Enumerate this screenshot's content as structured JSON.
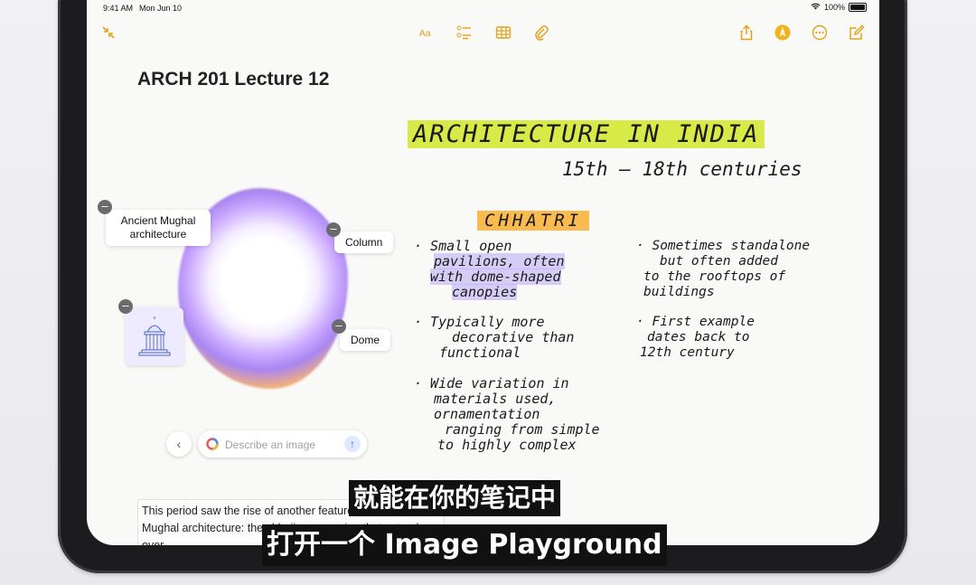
{
  "status": {
    "time": "9:41 AM",
    "date": "Mon Jun 10",
    "battery": "100%"
  },
  "note": {
    "title": "ARCH 201 Lecture 12"
  },
  "handwriting": {
    "heading": "ARCHITECTURE IN INDIA",
    "centuries": "15th – 18th centuries",
    "topic": "CHHATRI",
    "col1": [
      [
        "· Small open",
        "pavilions, often",
        "with dome-shaped",
        "canopies"
      ],
      [
        "· Typically more",
        "decorative than",
        "functional"
      ],
      [
        "· Wide variation in",
        "materials used,",
        "ornamentation",
        "ranging from simple",
        "to highly complex"
      ]
    ],
    "col2": [
      [
        "· Sometimes standalone",
        "but often added",
        "to the rooftops of",
        "buildings"
      ],
      [
        "· First example",
        "dates back to",
        "12th century"
      ]
    ]
  },
  "playground": {
    "chips": {
      "mughal": "Ancient Mughal architecture",
      "column": "Column",
      "dome": "Dome"
    },
    "prompt_placeholder": "Describe an image"
  },
  "body_text": "This period saw the rise of another feature associated with Mughal architecture: the chhajja, an awning that extends over",
  "subtitles": {
    "line1": "就能在你的笔记中",
    "line2": "打开一个 Image Playground"
  },
  "colors": {
    "accent": "#e2a21a",
    "highlight_green": "#d2e828",
    "highlight_orange": "#f8b23c"
  }
}
